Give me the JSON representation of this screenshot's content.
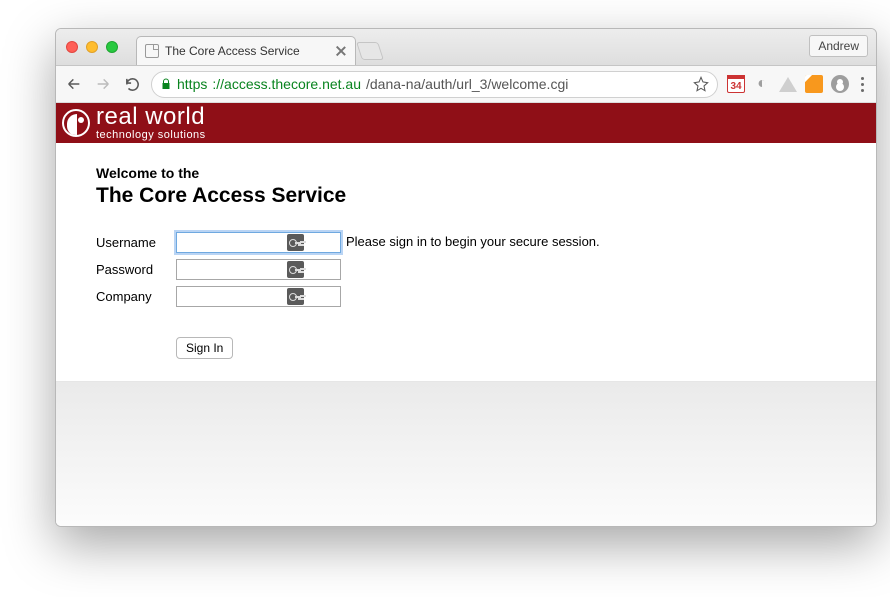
{
  "browser": {
    "tab_title": "The Core Access Service",
    "profile_name": "Andrew",
    "url": {
      "protocol": "https",
      "host": "://access.thecore.net.au",
      "path": "/dana-na/auth/url_3/welcome.cgi"
    },
    "calendar_day": "34"
  },
  "brand": {
    "main": "real world",
    "sub": "technology solutions"
  },
  "page": {
    "welcome_pre": "Welcome to the",
    "title": "The Core Access Service",
    "hint": "Please sign in to begin your secure session."
  },
  "form": {
    "username_label": "Username",
    "password_label": "Password",
    "company_label": "Company",
    "username_value": "",
    "password_value": "",
    "company_value": "",
    "submit_label": "Sign In"
  }
}
